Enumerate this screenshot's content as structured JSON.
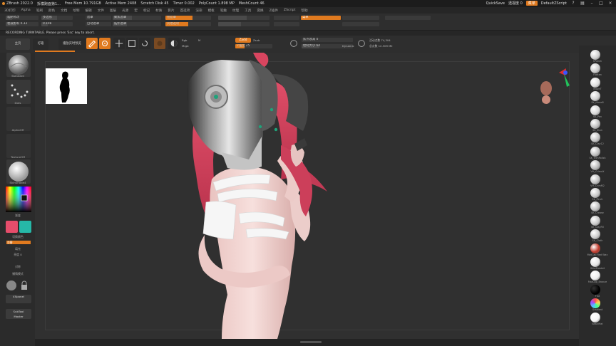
{
  "titlebar": {
    "app": "ZBrush 2022.0",
    "project": "拆模跑面第1...",
    "free_mem": "Free Mem 10.791GB",
    "active_mem": "Active Mem 2408",
    "scratch_disk": "Scratch Disk 45",
    "timer": "Timer 0.002",
    "poly_count": "PolyCount 1.898 MP",
    "mesh_count": "MeshCount 46",
    "quicksave": "QuickSave",
    "see_through": "透视度 0",
    "menus_tag": "菜单",
    "script": "DefaultZScript"
  },
  "menubar": {
    "items": [
      "3D打印",
      "Alpha",
      "笔刷",
      "颜色",
      "文档",
      "绘制",
      "编辑",
      "文件",
      "图层",
      "光源",
      "宏",
      "标记",
      "材质",
      "影片",
      "首选项",
      "渲染",
      "模板",
      "笔触",
      "纹理",
      "工具",
      "变换",
      "Z插件",
      "ZScript",
      "帮助"
    ]
  },
  "toolrow1": {
    "sliders": [
      {
        "label": "笔刷修改",
        "value": "0"
      },
      {
        "label": "衰减影响",
        "value": "0.33"
      },
      {
        "label": "多边形",
        "value": "0.210"
      },
      {
        "label": "模糊",
        "value": "0.198"
      }
    ],
    "labels": [
      "遮罩",
      "自动遮罩",
      "聚焦遮罩",
      "拓扑遮罩",
      "组遮罩",
      "其他选项"
    ],
    "orange_label": "菜单"
  },
  "notice": "RECORDING TURNTABLE. Please press 'Esc' key to abort.",
  "toolrow2": {
    "left_buttons": [
      "主页",
      "灯箱",
      "播放实时预览"
    ],
    "mode_buttons": [
      "Edit",
      "Draw",
      "Move",
      "Scale",
      "Rotate"
    ],
    "rgb_label": "Mrgb",
    "rgb_options": [
      "Rgb",
      "M"
    ],
    "zadd_label": "Zadd",
    "zsub_label": "Zsub",
    "focal_label": "焦点衰减",
    "focal_value": "0",
    "draw_size_label": "绘制大小",
    "draw_size_value": "64",
    "dynamic_label": "Dynamic",
    "z_intensity_label": "Z强度",
    "z_intensity_value": "25",
    "active_points_label": "活动点数",
    "active_points_value": "74,304",
    "total_points_label": "总点数",
    "total_points_value": "12.309 Mil"
  },
  "leftshelf": {
    "items": [
      {
        "label": "Standard"
      },
      {
        "label": "Dots"
      },
      {
        "label": "AlphaOff"
      },
      {
        "label": "TextureOff"
      },
      {
        "label": "SkinShade4"
      }
    ],
    "colors": {
      "primary": "#e64d6b",
      "secondary": "#26b8a8"
    },
    "color_label": "渐变",
    "switch_label": "切换颜色",
    "alternate_label": "交替",
    "fill_label": "填充",
    "bright_label": "亮度 0",
    "sym_label": "对称",
    "lazy_label": "懒惰模式",
    "hide_label": "隐藏组",
    "capture_btn": "XSpanel",
    "subtool_btn_1": "SubTool",
    "subtool_btn_2": "Master"
  },
  "rightshelf": {
    "brushes": [
      {
        "label": "hPolish",
        "color": "#cfcfcf"
      },
      {
        "label": "Flatten",
        "color": "#c9c9c9"
      },
      {
        "label": "MoveT",
        "color": "#dcdcdc"
      },
      {
        "label": "SK_Move8",
        "color": "#d0d0d0"
      },
      {
        "label": "SK_Pen",
        "color": "#d5d5d5"
      },
      {
        "label": "SK_Stan",
        "color": "#bebebe"
      },
      {
        "label": "SK_Clay12",
        "color": "#c4c4c4"
      },
      {
        "label": "SK_TrimPolish",
        "color": "#bdbdbd"
      },
      {
        "label": "VH_CrimeX",
        "color": "#b9b9b9"
      },
      {
        "label": "VH_CrimM2",
        "color": "#c0c0c0"
      },
      {
        "label": "SK_Pinch",
        "color": "#c6c6c6"
      },
      {
        "label": "SK_Crease",
        "color": "#bfbfbf"
      },
      {
        "label": "SK_ClayFill",
        "color": "#c8c8c8"
      },
      {
        "label": "SK_Cloth",
        "color": "#cacaca"
      },
      {
        "label": "MatCap Red Wax",
        "color": "#c0392b"
      },
      {
        "label": "SkinShade4",
        "color": "#e3e3e3"
      },
      {
        "label": "MatCap_Bronze",
        "color": "#ededed"
      },
      {
        "label": "Flat",
        "color": "#000000"
      },
      {
        "label": "Gradient",
        "color": "#a070d0"
      },
      {
        "label": "BasicMat",
        "color": "#f5f5f5"
      }
    ]
  },
  "colors": {
    "accent": "#e07a1f",
    "bg": "#2b2b2b",
    "hair": "#d9455f",
    "helmet": "#b9b9b9",
    "skin": "#f2d2cf",
    "bandage": "#f5f5f5"
  }
}
